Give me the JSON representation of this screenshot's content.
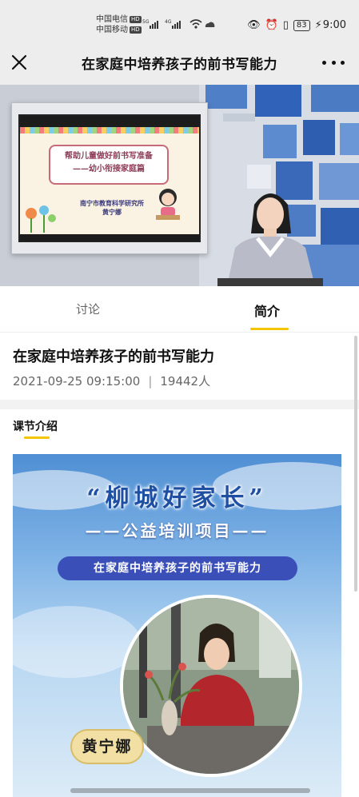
{
  "status_bar": {
    "carrier_1": "中国电信",
    "carrier_2": "中国移动",
    "hd_label": "HD",
    "net_1": "5G",
    "net_2": "4G",
    "battery": "83",
    "time": "9:00",
    "icons": [
      "signal-icon",
      "wifi-icon",
      "cloud-icon",
      "eye-icon",
      "alarm-icon",
      "vibrate-icon",
      "charging-icon"
    ]
  },
  "header": {
    "title": "在家庭中培养孩子的前书写能力",
    "close_icon": "close-icon",
    "more_icon": "more-icon"
  },
  "video": {
    "slide_title_1": "帮助儿童做好前书写准备",
    "slide_title_2": "——幼小衔接家庭篇",
    "slide_org": "南宁市教育科学研究所",
    "slide_author": "黄宁娜"
  },
  "tabs": [
    {
      "label": "讨论",
      "active": false
    },
    {
      "label": "简介",
      "active": true
    }
  ],
  "lesson": {
    "title": "在家庭中培养孩子的前书写能力",
    "datetime": "2021-09-25 09:15:00",
    "separator": "|",
    "viewers": "19442人"
  },
  "section": {
    "title": "课节介绍"
  },
  "poster": {
    "headline": "“柳城好家长”",
    "subtitle": "——公益培训项目——",
    "banner": "在家庭中培养孩子的前书写能力",
    "name": "黄宁娜"
  },
  "colors": {
    "accent": "#f5c500",
    "header_bg": "#ededed",
    "poster_blue": "#3a4fb8"
  }
}
